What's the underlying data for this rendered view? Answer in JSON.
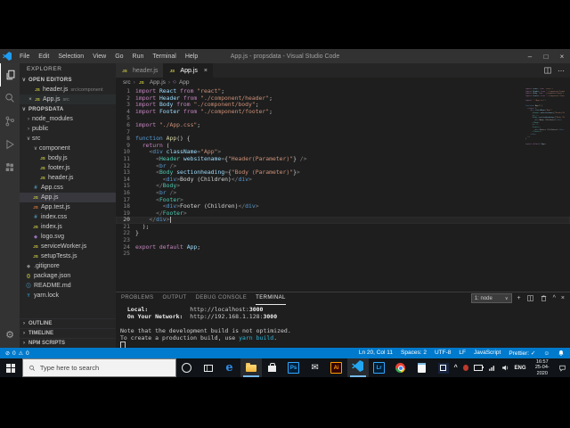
{
  "window": {
    "title": "App.js - propsdata - Visual Studio Code",
    "menus": [
      "File",
      "Edit",
      "Selection",
      "View",
      "Go",
      "Run",
      "Terminal",
      "Help"
    ]
  },
  "icons": {
    "js": "JS",
    "testjs": "JS",
    "css": "#",
    "svg": "◈",
    "git": "◆",
    "json": "{}",
    "info": "ⓘ",
    "yarn": "Y",
    "close": "×",
    "minimize": "–",
    "maximize": "□",
    "expanded": "∨",
    "collapsed": "›",
    "breadcrumb-sep": "›",
    "symbol": "◇",
    "chevron-up": "^",
    "chevron-down": "∨",
    "plus": "+",
    "more": "⋯",
    "warning": "⚠",
    "error": "⊘",
    "smiley": "☺",
    "check": "✓",
    "edge": "e",
    "mail": "✉",
    "gear": "⚙"
  },
  "sidebar": {
    "title": "EXPLORER",
    "open_editors": {
      "label": "OPEN EDITORS",
      "items": [
        {
          "name": "header.js",
          "path": "src\\component",
          "active": false
        },
        {
          "name": "App.js",
          "path": "src",
          "active": true
        }
      ]
    },
    "project": {
      "label": "PROPSDATA",
      "items": [
        {
          "label": "node_modules",
          "chev": "collapsed",
          "indent": 0
        },
        {
          "label": "public",
          "chev": "collapsed",
          "indent": 0
        },
        {
          "label": "src",
          "chev": "expanded",
          "indent": 0
        },
        {
          "label": "component",
          "chev": "expanded",
          "indent": 1
        },
        {
          "label": "body.js",
          "icon": "js",
          "indent": 2
        },
        {
          "label": "footer.js",
          "icon": "js",
          "indent": 2
        },
        {
          "label": "header.js",
          "icon": "js",
          "indent": 2
        },
        {
          "label": "App.css",
          "icon": "css",
          "indent": 1
        },
        {
          "label": "App.js",
          "icon": "js",
          "indent": 1,
          "selected": true
        },
        {
          "label": "App.test.js",
          "icon": "testjs",
          "indent": 1
        },
        {
          "label": "index.css",
          "icon": "css",
          "indent": 1
        },
        {
          "label": "index.js",
          "icon": "js",
          "indent": 1
        },
        {
          "label": "logo.svg",
          "icon": "svg",
          "indent": 1
        },
        {
          "label": "serviceWorker.js",
          "icon": "js",
          "indent": 1
        },
        {
          "label": "setupTests.js",
          "icon": "js",
          "indent": 1
        },
        {
          "label": ".gitignore",
          "icon": "git",
          "indent": 0
        },
        {
          "label": "package.json",
          "icon": "json",
          "indent": 0
        },
        {
          "label": "README.md",
          "icon": "info",
          "indent": 0
        },
        {
          "label": "yarn.lock",
          "icon": "yarn",
          "indent": 0
        }
      ]
    },
    "bottom_sections": [
      "OUTLINE",
      "TIMELINE",
      "NPM SCRIPTS"
    ]
  },
  "editor": {
    "tabs": [
      {
        "label": "header.js",
        "active": false
      },
      {
        "label": "App.js",
        "active": true
      }
    ],
    "breadcrumb": [
      "src",
      "App.js",
      "App"
    ],
    "code": {
      "cursor_line": 20,
      "lines": [
        [
          [
            "k",
            "import "
          ],
          [
            "v",
            "React "
          ],
          [
            "k",
            "from "
          ],
          [
            "s",
            "\"react\""
          ],
          [
            "p",
            ";"
          ]
        ],
        [
          [
            "k",
            "import "
          ],
          [
            "v",
            "Header "
          ],
          [
            "k",
            "from "
          ],
          [
            "s",
            "\"./component/header\""
          ],
          [
            "p",
            ";"
          ]
        ],
        [
          [
            "k",
            "import "
          ],
          [
            "v",
            "Body "
          ],
          [
            "k",
            "from "
          ],
          [
            "s",
            "\"./component/body\""
          ],
          [
            "p",
            ";"
          ]
        ],
        [
          [
            "k",
            "import "
          ],
          [
            "v",
            "Footer "
          ],
          [
            "k",
            "from "
          ],
          [
            "s",
            "\"./component/footer\""
          ],
          [
            "p",
            ";"
          ]
        ],
        [],
        [
          [
            "k",
            "import "
          ],
          [
            "s",
            "\"./App.css\""
          ],
          [
            "p",
            ";"
          ]
        ],
        [],
        [
          [
            "kb",
            "function "
          ],
          [
            "f",
            "App"
          ],
          [
            "p",
            "() {"
          ]
        ],
        [
          [
            "p",
            "  "
          ],
          [
            "k",
            "return"
          ],
          [
            "p",
            " ("
          ]
        ],
        [
          [
            "p",
            "    "
          ],
          [
            "pu",
            "<"
          ],
          [
            "t",
            "div"
          ],
          [
            "p",
            " "
          ],
          [
            "a",
            "className"
          ],
          [
            "pu",
            "="
          ],
          [
            "s",
            "\"App\""
          ],
          [
            "pu",
            ">"
          ]
        ],
        [
          [
            "p",
            "      "
          ],
          [
            "pu",
            "<"
          ],
          [
            "c",
            "Header"
          ],
          [
            "p",
            " "
          ],
          [
            "a",
            "websitename"
          ],
          [
            "pu",
            "="
          ],
          [
            "b",
            "{"
          ],
          [
            "s",
            "\"Header(Parameter)\""
          ],
          [
            "b",
            "}"
          ],
          [
            "p",
            " "
          ],
          [
            "pu",
            "/>"
          ]
        ],
        [
          [
            "p",
            "      "
          ],
          [
            "pu",
            "<"
          ],
          [
            "t",
            "br"
          ],
          [
            "p",
            " "
          ],
          [
            "pu",
            "/>"
          ]
        ],
        [
          [
            "p",
            "      "
          ],
          [
            "pu",
            "<"
          ],
          [
            "c",
            "Body"
          ],
          [
            "p",
            " "
          ],
          [
            "a",
            "sectionheading"
          ],
          [
            "pu",
            "="
          ],
          [
            "b",
            "{"
          ],
          [
            "s",
            "\"Body (Parameter)\""
          ],
          [
            "b",
            "}"
          ],
          [
            "pu",
            ">"
          ]
        ],
        [
          [
            "p",
            "        "
          ],
          [
            "pu",
            "<"
          ],
          [
            "t",
            "div"
          ],
          [
            "pu",
            ">"
          ],
          [
            "p",
            "Body (Children)"
          ],
          [
            "pu",
            "</"
          ],
          [
            "t",
            "div"
          ],
          [
            "pu",
            ">"
          ]
        ],
        [
          [
            "p",
            "      "
          ],
          [
            "pu",
            "</"
          ],
          [
            "c",
            "Body"
          ],
          [
            "pu",
            ">"
          ]
        ],
        [
          [
            "p",
            "      "
          ],
          [
            "pu",
            "<"
          ],
          [
            "t",
            "br"
          ],
          [
            "p",
            " "
          ],
          [
            "pu",
            "/>"
          ]
        ],
        [
          [
            "p",
            "      "
          ],
          [
            "pu",
            "<"
          ],
          [
            "c",
            "Footer"
          ],
          [
            "pu",
            ">"
          ]
        ],
        [
          [
            "p",
            "        "
          ],
          [
            "pu",
            "<"
          ],
          [
            "t",
            "div"
          ],
          [
            "pu",
            ">"
          ],
          [
            "p",
            "Footer (Children)"
          ],
          [
            "pu",
            "</"
          ],
          [
            "t",
            "div"
          ],
          [
            "pu",
            ">"
          ]
        ],
        [
          [
            "p",
            "      "
          ],
          [
            "pu",
            "</"
          ],
          [
            "c",
            "Footer"
          ],
          [
            "pu",
            ">"
          ]
        ],
        [
          [
            "p",
            "    "
          ],
          [
            "pu",
            "</"
          ],
          [
            "t",
            "div"
          ],
          [
            "pu",
            ">"
          ]
        ],
        [
          [
            "p",
            "  );"
          ]
        ],
        [
          [
            "p",
            "}"
          ]
        ],
        [],
        [
          [
            "k",
            "export default "
          ],
          [
            "v",
            "App"
          ],
          [
            "p",
            ";"
          ]
        ],
        []
      ]
    }
  },
  "panel": {
    "tabs": [
      "PROBLEMS",
      "OUTPUT",
      "DEBUG CONSOLE",
      "TERMINAL"
    ],
    "active_tab": "TERMINAL",
    "shell_selector": "1: node",
    "terminal_lines": [
      [
        [
          "lbl",
          "  Local:            "
        ],
        [
          "txt",
          "http://localhost:"
        ],
        [
          "port",
          "3000"
        ]
      ],
      [
        [
          "lbl",
          "  On Your Network:  "
        ],
        [
          "txt",
          "http://192.168.1.128:"
        ],
        [
          "port",
          "3000"
        ]
      ],
      [],
      [
        [
          "txt",
          "Note that the development build is not optimized."
        ]
      ],
      [
        [
          "txt",
          "To create a production build, use "
        ],
        [
          "cmd",
          "yarn build"
        ],
        [
          "txt",
          "."
        ]
      ],
      [
        [
          "cursor",
          ""
        ]
      ]
    ]
  },
  "status_bar": {
    "errors": "0",
    "warnings": "0",
    "items": [
      "Ln 20, Col 11",
      "Spaces: 2",
      "UTF-8",
      "LF",
      "JavaScript",
      "Prettier: ✓"
    ]
  },
  "taskbar": {
    "search_placeholder": "Type here to search",
    "apps": [
      {
        "name": "cortana"
      },
      {
        "name": "task-view"
      },
      {
        "name": "edge"
      },
      {
        "name": "file-explorer",
        "active": true
      },
      {
        "name": "store"
      },
      {
        "name": "photoshop",
        "label": "Ps"
      },
      {
        "name": "mail"
      },
      {
        "name": "illustrator",
        "label": "Ai"
      },
      {
        "name": "vscode",
        "active": true
      },
      {
        "name": "lightroom",
        "label": "Lr"
      },
      {
        "name": "chrome"
      },
      {
        "name": "notepad"
      },
      {
        "name": "media-player"
      }
    ],
    "tray": {
      "lang": "ENG",
      "time": "16:57",
      "date": "25-04-2020"
    }
  },
  "colors": {
    "status_bar": "#007acc",
    "editor_bg": "#1e1e1e",
    "sidebar_bg": "#252526",
    "activity_bg": "#333333",
    "titlebar_bg": "#323233",
    "accent_blue": "#1f9cf0"
  }
}
